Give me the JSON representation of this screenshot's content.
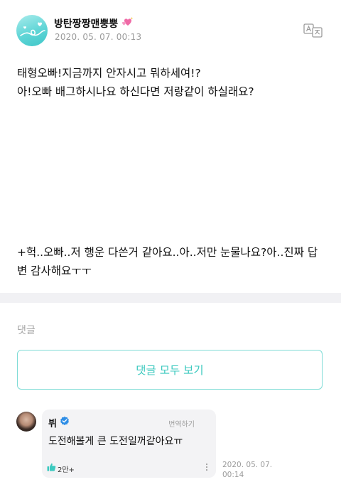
{
  "post": {
    "username": "방탄짱짱맨뿡뿡",
    "date": "2020. 05. 07. 00:13",
    "lines": [
      "태형오빠!지금까지 안자시고 뭐하세여!?",
      "아!오빠 배그하시나요 하신다면 저랑같이 하실래요?"
    ],
    "extra": "+헉..오빠..저 행운 다쓴거 같아요..아..저만 눈물나요?아..진짜 답변 감사해요ㅜㅜ",
    "icons": {
      "translate": "translate-icon",
      "heart": "sparkling-heart-icon"
    }
  },
  "comments": {
    "label": "댓글",
    "view_all": "댓글 모두 보기",
    "items": [
      {
        "author": "뷔",
        "translate": "번역하기",
        "text": "도전해볼게 큰 도전일꺼같아요ㅠ",
        "likes": "2만+",
        "date": "2020. 05. 07. 00:14"
      }
    ]
  },
  "colors": {
    "accent": "#3cc9bf",
    "accent_border": "#7fdcd6",
    "muted": "#9b9b9b",
    "divider": "#f1f1f4",
    "bubble": "#f3f3f5",
    "verified": "#2f8ee6",
    "like": "#3cc9bf"
  }
}
